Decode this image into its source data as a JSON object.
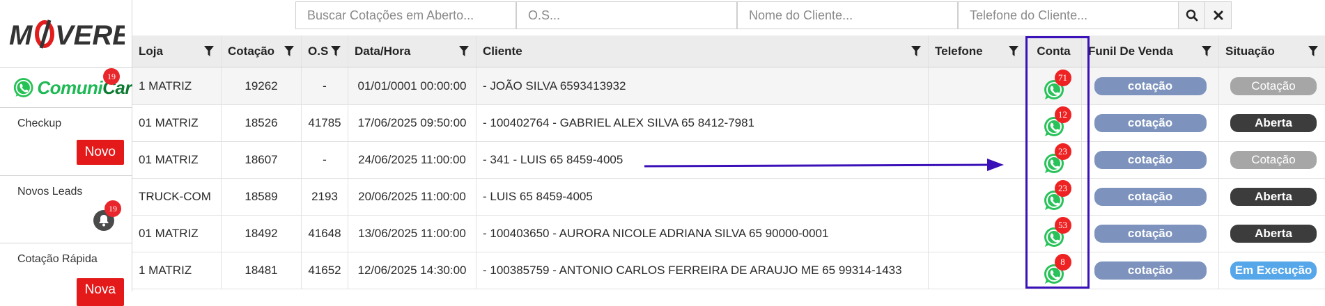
{
  "sidebar": {
    "logo_text": "MOVERE",
    "comunicar": {
      "part1": "Comuni",
      "part2": "Car",
      "badge": "19"
    },
    "checkup": {
      "label": "Checkup",
      "button": "Novo"
    },
    "novos_leads": {
      "label": "Novos Leads",
      "badge": "19"
    },
    "cotacao_rapida": {
      "label": "Cotação Rápida",
      "button": "Nova"
    }
  },
  "search": {
    "placeholder_open_quotes": "Buscar Cotações em Aberto...",
    "placeholder_os": "O.S...",
    "placeholder_client_name": "Nome do Cliente...",
    "placeholder_client_phone": "Telefone do Cliente..."
  },
  "table": {
    "headers": {
      "loja": "Loja",
      "cotacao": "Cotação",
      "os": "O.S",
      "datahora": "Data/Hora",
      "cliente": "Cliente",
      "telefone": "Telefone",
      "conta": "Conta",
      "funil": "Funil De Venda",
      "situacao": "Situação"
    },
    "rows": [
      {
        "loja": "1 MATRIZ",
        "cotacao": "19262",
        "os": "-",
        "datahora": "01/01/0001 00:00:00",
        "cliente": "- JOÃO SILVA 6593413932",
        "conta": "71",
        "funil": "cotação",
        "situacao": "Cotação",
        "sit_type": "cotacao"
      },
      {
        "loja": "01 MATRIZ",
        "cotacao": "18526",
        "os": "41785",
        "datahora": "17/06/2025 09:50:00",
        "cliente": "- 100402764 - GABRIEL ALEX SILVA 65 8412-7981",
        "conta": "12",
        "funil": "cotação",
        "situacao": "Aberta",
        "sit_type": "aberta"
      },
      {
        "loja": "01 MATRIZ",
        "cotacao": "18607",
        "os": "-",
        "datahora": "24/06/2025 11:00:00",
        "cliente": "- 341 - LUIS 65 8459-4005",
        "conta": "23",
        "funil": "cotação",
        "situacao": "Cotação",
        "sit_type": "cotacao"
      },
      {
        "loja": "TRUCK-COM",
        "cotacao": "18589",
        "os": "2193",
        "datahora": "20/06/2025 11:00:00",
        "cliente": "- LUIS 65 8459-4005",
        "conta": "23",
        "funil": "cotação",
        "situacao": "Aberta",
        "sit_type": "aberta"
      },
      {
        "loja": "01 MATRIZ",
        "cotacao": "18492",
        "os": "41648",
        "datahora": "13/06/2025 11:00:00",
        "cliente": "- 100403650 - AURORA NICOLE ADRIANA SILVA 65 90000-0001",
        "conta": "53",
        "funil": "cotação",
        "situacao": "Aberta",
        "sit_type": "aberta"
      },
      {
        "loja": "1 MATRIZ",
        "cotacao": "18481",
        "os": "41652",
        "datahora": "12/06/2025 14:30:00",
        "cliente": "- 100385759 - ANTONIO CARLOS FERREIRA DE ARAUJO ME 65 99314-1433",
        "conta": "8",
        "funil": "cotação",
        "situacao": "Em Execução",
        "sit_type": "exec"
      }
    ]
  },
  "colors": {
    "brand_red": "#e41a1a",
    "funil_pill": "#7d93bd",
    "situacao_cotacao": "#a6a6a6",
    "situacao_aberta": "#3c3c3c",
    "situacao_execucao": "#55a7ea",
    "annotation": "#3a10b8"
  }
}
